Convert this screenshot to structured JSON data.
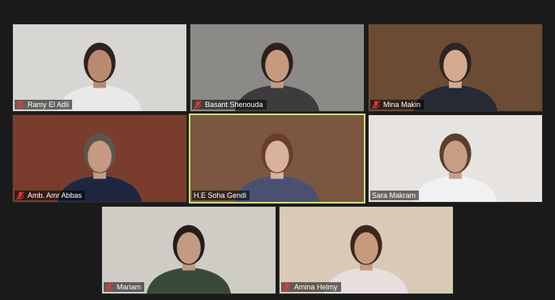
{
  "participants": [
    {
      "name": "Ramy El Adli",
      "bg": "#d8d6d2",
      "skin": "#b98a6e",
      "shirt": "#e9e9ea",
      "hair": "#2a2320"
    },
    {
      "name": "Basant Shenouda",
      "bg": "#8c8a86",
      "skin": "#c79a80",
      "shirt": "#3c3b3e",
      "hair": "#2b2019"
    },
    {
      "name": "Mina Makin",
      "bg": "#6b4b33",
      "skin": "#d4ab90",
      "shirt": "#252a33",
      "hair": "#2c2520"
    },
    {
      "name": "Amb. Amr Abbas",
      "bg": "#7a3c2c",
      "skin": "#c69a80",
      "shirt": "#1f2740",
      "hair": "#5b5550"
    },
    {
      "name": "H.E Soha Gendi",
      "bg": "#7b5640",
      "skin": "#d9b29b",
      "shirt": "#4b5070",
      "hair": "#6a3d2a"
    },
    {
      "name": "Sara Makram",
      "bg": "#e7e3e0",
      "skin": "#c99e86",
      "shirt": "#f2f1f1",
      "hair": "#5a3f2c"
    },
    {
      "name": "Mariam",
      "bg": "#cfccc5",
      "skin": "#c39a82",
      "shirt": "#3a4a3a",
      "hair": "#231d1b"
    },
    {
      "name": "Amina Helmy",
      "bg": "#d9c9b6",
      "skin": "#c79a80",
      "shirt": "#e6dfdb",
      "hair": "#3b281d"
    }
  ],
  "active_speaker_color": "#c9e36a",
  "muted_icon_color": "#e03b3b"
}
